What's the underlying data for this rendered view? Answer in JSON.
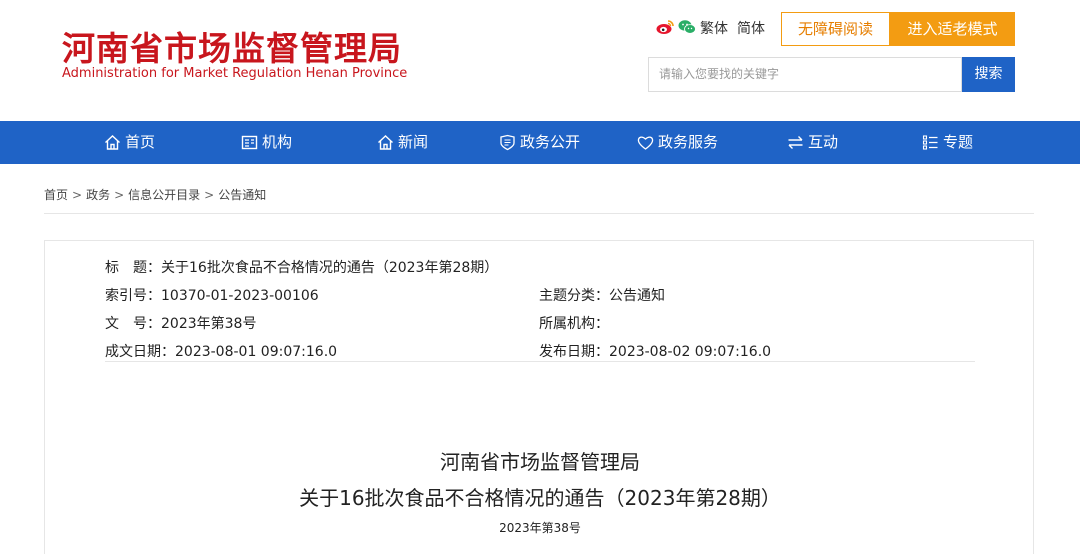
{
  "header": {
    "logo_cn": "河南省市场监督管理局",
    "logo_en": "Administration for Market Regulation Henan Province",
    "social_icons": [
      "weibo-icon",
      "wechat-icon"
    ],
    "lang_traditional": "繁体",
    "lang_simplified": "简体",
    "accessibility_label": "无障碍阅读",
    "elder_mode_label": "进入适老模式",
    "search_placeholder": "请输入您要找的关键字",
    "search_button": "搜索"
  },
  "nav": {
    "items": [
      {
        "label": "首页",
        "icon": "home-icon"
      },
      {
        "label": "机构",
        "icon": "building-icon"
      },
      {
        "label": "新闻",
        "icon": "home-icon"
      },
      {
        "label": "政务公开",
        "icon": "shield-book-icon"
      },
      {
        "label": "政务服务",
        "icon": "heart-icon"
      },
      {
        "label": "互动",
        "icon": "exchange-icon"
      },
      {
        "label": "专题",
        "icon": "list-icon"
      }
    ]
  },
  "breadcrumb": [
    "首页",
    "政务",
    "信息公开目录",
    "公告通知"
  ],
  "meta": {
    "title_label": "标　题：",
    "title_value": "关于16批次食品不合格情况的通告（2023年第28期）",
    "index_label": "索引号：",
    "index_value": "10370-01-2023-00106",
    "category_label": "主题分类：",
    "category_value": "公告通知",
    "docnum_label": "文　号：",
    "docnum_value": "2023年第38号",
    "org_label": "所属机构：",
    "org_value": "",
    "created_label": "成文日期：",
    "created_value": "2023-08-01 09:07:16.0",
    "published_label": "发布日期：",
    "published_value": "2023-08-02 09:07:16.0"
  },
  "document": {
    "org": "河南省市场监督管理局",
    "title": "关于16批次食品不合格情况的通告（2023年第28期）",
    "number": "2023年第38号"
  },
  "colors": {
    "brand_red": "#c8161d",
    "nav_blue": "#1f63c6",
    "orange": "#f39c12"
  }
}
